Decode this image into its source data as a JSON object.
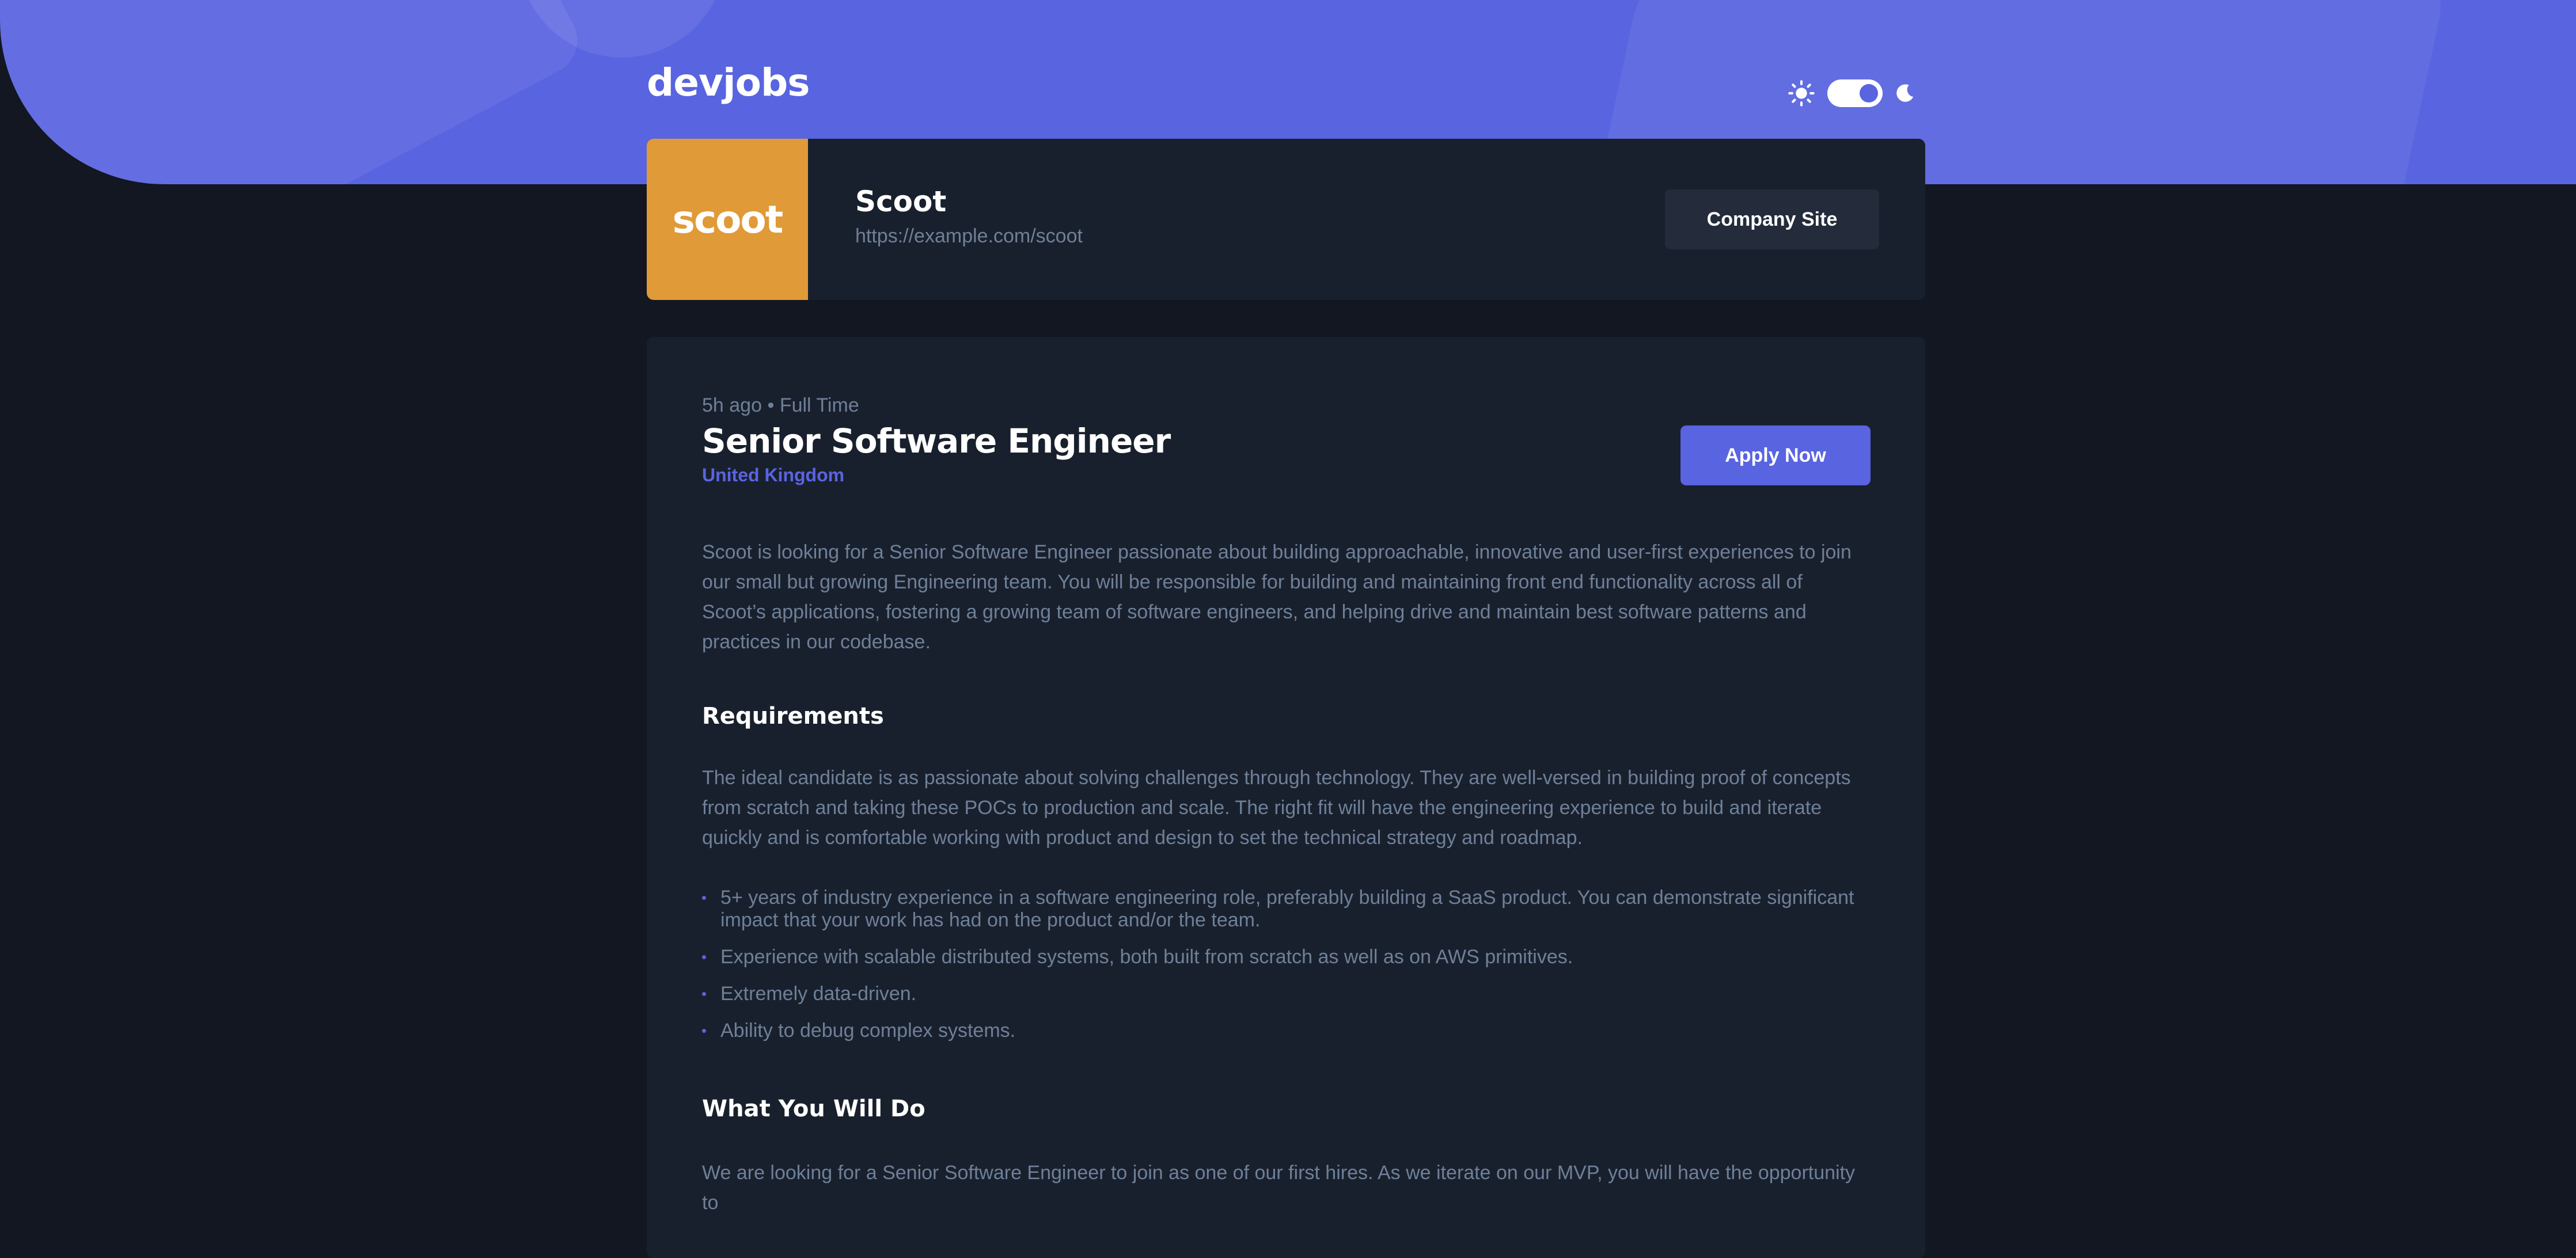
{
  "header": {
    "logo": "devjobs",
    "theme_toggle": {
      "mode": "dark",
      "sun_icon": "sun-icon",
      "moon_icon": "moon-icon"
    }
  },
  "company": {
    "logo_text": "scoot",
    "logo_color": "#e19a38",
    "name": "Scoot",
    "url": "https://example.com/scoot",
    "site_button_label": "Company Site"
  },
  "job": {
    "posted": "5h ago",
    "separator": "•",
    "contract": "Full Time",
    "title": "Senior Software Engineer",
    "location": "United Kingdom",
    "apply_label": "Apply Now",
    "description": "Scoot is looking for a Senior Software Engineer passionate about building approachable, innovative and user-first experiences to join our small but growing Engineering team. You will be responsible for building and maintaining front end functionality across all of Scoot’s applications, fostering a growing team of software engineers, and helping drive and maintain best software patterns and practices in our codebase.",
    "requirements": {
      "heading": "Requirements",
      "content": "The ideal candidate is as passionate about solving challenges through technology. They are well-versed in building proof of concepts from scratch and taking these POCs to production and scale. The right fit will have the engineering experience to build and iterate quickly and is comfortable working with product and design to set the technical strategy and roadmap.",
      "items": [
        "5+ years of industry experience in a software engineering role, preferably building a SaaS product. You can demonstrate significant impact that your work has had on the product and/or the team.",
        "Experience with scalable distributed systems, both built from scratch as well as on AWS primitives.",
        "Extremely data-driven.",
        "Ability to debug complex systems."
      ]
    },
    "role": {
      "heading": "What You Will Do",
      "content": "We are looking for a Senior Software Engineer to join as one of our first hires. As we iterate on our MVP, you will have the opportunity to"
    }
  },
  "colors": {
    "accent": "#5964e0",
    "background": "#121721",
    "card": "#19202d",
    "muted_text": "#6e8098"
  }
}
